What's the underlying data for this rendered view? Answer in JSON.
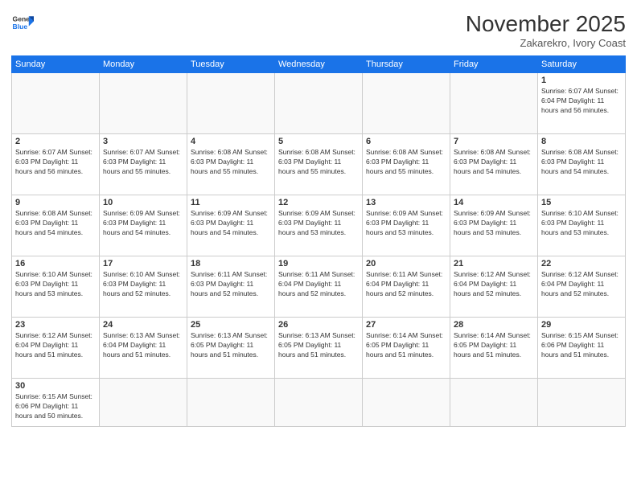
{
  "header": {
    "logo_general": "General",
    "logo_blue": "Blue",
    "title": "November 2025",
    "location": "Zakarekro, Ivory Coast"
  },
  "days_of_week": [
    "Sunday",
    "Monday",
    "Tuesday",
    "Wednesday",
    "Thursday",
    "Friday",
    "Saturday"
  ],
  "weeks": [
    [
      {
        "day": "",
        "info": ""
      },
      {
        "day": "",
        "info": ""
      },
      {
        "day": "",
        "info": ""
      },
      {
        "day": "",
        "info": ""
      },
      {
        "day": "",
        "info": ""
      },
      {
        "day": "",
        "info": ""
      },
      {
        "day": "1",
        "info": "Sunrise: 6:07 AM\nSunset: 6:04 PM\nDaylight: 11 hours\nand 56 minutes."
      }
    ],
    [
      {
        "day": "2",
        "info": "Sunrise: 6:07 AM\nSunset: 6:03 PM\nDaylight: 11 hours\nand 56 minutes."
      },
      {
        "day": "3",
        "info": "Sunrise: 6:07 AM\nSunset: 6:03 PM\nDaylight: 11 hours\nand 55 minutes."
      },
      {
        "day": "4",
        "info": "Sunrise: 6:08 AM\nSunset: 6:03 PM\nDaylight: 11 hours\nand 55 minutes."
      },
      {
        "day": "5",
        "info": "Sunrise: 6:08 AM\nSunset: 6:03 PM\nDaylight: 11 hours\nand 55 minutes."
      },
      {
        "day": "6",
        "info": "Sunrise: 6:08 AM\nSunset: 6:03 PM\nDaylight: 11 hours\nand 55 minutes."
      },
      {
        "day": "7",
        "info": "Sunrise: 6:08 AM\nSunset: 6:03 PM\nDaylight: 11 hours\nand 54 minutes."
      },
      {
        "day": "8",
        "info": "Sunrise: 6:08 AM\nSunset: 6:03 PM\nDaylight: 11 hours\nand 54 minutes."
      }
    ],
    [
      {
        "day": "9",
        "info": "Sunrise: 6:08 AM\nSunset: 6:03 PM\nDaylight: 11 hours\nand 54 minutes."
      },
      {
        "day": "10",
        "info": "Sunrise: 6:09 AM\nSunset: 6:03 PM\nDaylight: 11 hours\nand 54 minutes."
      },
      {
        "day": "11",
        "info": "Sunrise: 6:09 AM\nSunset: 6:03 PM\nDaylight: 11 hours\nand 54 minutes."
      },
      {
        "day": "12",
        "info": "Sunrise: 6:09 AM\nSunset: 6:03 PM\nDaylight: 11 hours\nand 53 minutes."
      },
      {
        "day": "13",
        "info": "Sunrise: 6:09 AM\nSunset: 6:03 PM\nDaylight: 11 hours\nand 53 minutes."
      },
      {
        "day": "14",
        "info": "Sunrise: 6:09 AM\nSunset: 6:03 PM\nDaylight: 11 hours\nand 53 minutes."
      },
      {
        "day": "15",
        "info": "Sunrise: 6:10 AM\nSunset: 6:03 PM\nDaylight: 11 hours\nand 53 minutes."
      }
    ],
    [
      {
        "day": "16",
        "info": "Sunrise: 6:10 AM\nSunset: 6:03 PM\nDaylight: 11 hours\nand 53 minutes."
      },
      {
        "day": "17",
        "info": "Sunrise: 6:10 AM\nSunset: 6:03 PM\nDaylight: 11 hours\nand 52 minutes."
      },
      {
        "day": "18",
        "info": "Sunrise: 6:11 AM\nSunset: 6:03 PM\nDaylight: 11 hours\nand 52 minutes."
      },
      {
        "day": "19",
        "info": "Sunrise: 6:11 AM\nSunset: 6:04 PM\nDaylight: 11 hours\nand 52 minutes."
      },
      {
        "day": "20",
        "info": "Sunrise: 6:11 AM\nSunset: 6:04 PM\nDaylight: 11 hours\nand 52 minutes."
      },
      {
        "day": "21",
        "info": "Sunrise: 6:12 AM\nSunset: 6:04 PM\nDaylight: 11 hours\nand 52 minutes."
      },
      {
        "day": "22",
        "info": "Sunrise: 6:12 AM\nSunset: 6:04 PM\nDaylight: 11 hours\nand 52 minutes."
      }
    ],
    [
      {
        "day": "23",
        "info": "Sunrise: 6:12 AM\nSunset: 6:04 PM\nDaylight: 11 hours\nand 51 minutes."
      },
      {
        "day": "24",
        "info": "Sunrise: 6:13 AM\nSunset: 6:04 PM\nDaylight: 11 hours\nand 51 minutes."
      },
      {
        "day": "25",
        "info": "Sunrise: 6:13 AM\nSunset: 6:05 PM\nDaylight: 11 hours\nand 51 minutes."
      },
      {
        "day": "26",
        "info": "Sunrise: 6:13 AM\nSunset: 6:05 PM\nDaylight: 11 hours\nand 51 minutes."
      },
      {
        "day": "27",
        "info": "Sunrise: 6:14 AM\nSunset: 6:05 PM\nDaylight: 11 hours\nand 51 minutes."
      },
      {
        "day": "28",
        "info": "Sunrise: 6:14 AM\nSunset: 6:05 PM\nDaylight: 11 hours\nand 51 minutes."
      },
      {
        "day": "29",
        "info": "Sunrise: 6:15 AM\nSunset: 6:06 PM\nDaylight: 11 hours\nand 51 minutes."
      }
    ],
    [
      {
        "day": "30",
        "info": "Sunrise: 6:15 AM\nSunset: 6:06 PM\nDaylight: 11 hours\nand 50 minutes."
      },
      {
        "day": "",
        "info": ""
      },
      {
        "day": "",
        "info": ""
      },
      {
        "day": "",
        "info": ""
      },
      {
        "day": "",
        "info": ""
      },
      {
        "day": "",
        "info": ""
      },
      {
        "day": "",
        "info": ""
      }
    ]
  ]
}
